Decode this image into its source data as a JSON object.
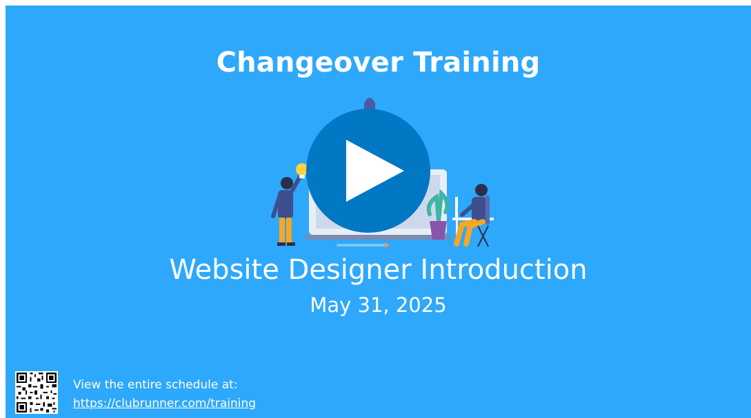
{
  "slide": {
    "title": "Changeover Training",
    "subtitle": "Website Designer Introduction",
    "date": "May 31, 2025",
    "schedule_label": "View the entire schedule at:",
    "schedule_link": "https://clubrunner.com/training"
  },
  "video": {
    "play_icon": "play-icon"
  },
  "colors": {
    "background": "#2ea8fb",
    "play_button": "#0277c4",
    "text": "#ffffff"
  }
}
